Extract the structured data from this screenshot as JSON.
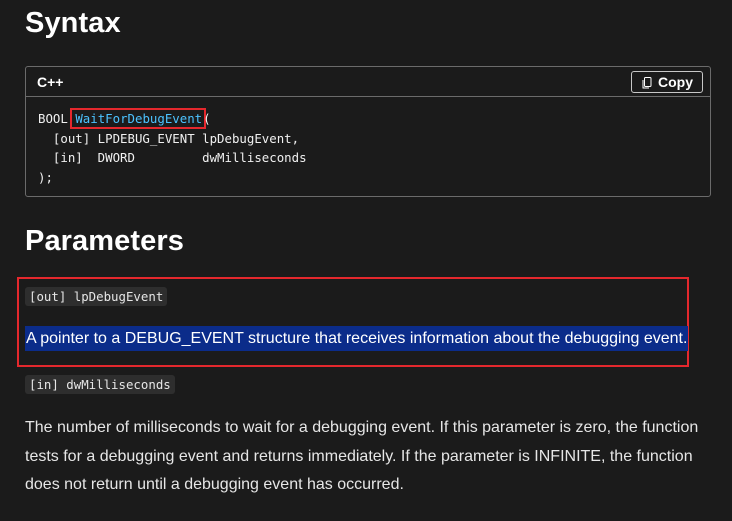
{
  "syntax": {
    "heading": "Syntax",
    "language": "C++",
    "copy_label": "Copy",
    "code": {
      "return_type": "BOOL ",
      "function_name": "WaitForDebugEvent",
      "open_paren": "(",
      "line2": "  [out] LPDEBUG_EVENT lpDebugEvent,",
      "line3": "  [in]  DWORD         dwMilliseconds",
      "line4": ");"
    }
  },
  "parameters": {
    "heading": "Parameters",
    "items": [
      {
        "name": "[out] lpDebugEvent",
        "description": "A pointer to a DEBUG_EVENT structure that receives information about the debugging event."
      },
      {
        "name": "[in] dwMilliseconds",
        "description_lines": [
          "The number of milliseconds to wait for a debugging event. If this parameter is zero, the function",
          "tests for a debugging event and returns immediately. If the parameter is INFINITE, the function",
          "does not return until a debugging event has occurred."
        ]
      }
    ]
  },
  "colors": {
    "background": "#1b1b1b",
    "link": "#4cc2ff",
    "annotation_red": "#e5282d",
    "selection_blue": "#0b2c8a"
  },
  "icons": {
    "copy": "copy-icon"
  }
}
